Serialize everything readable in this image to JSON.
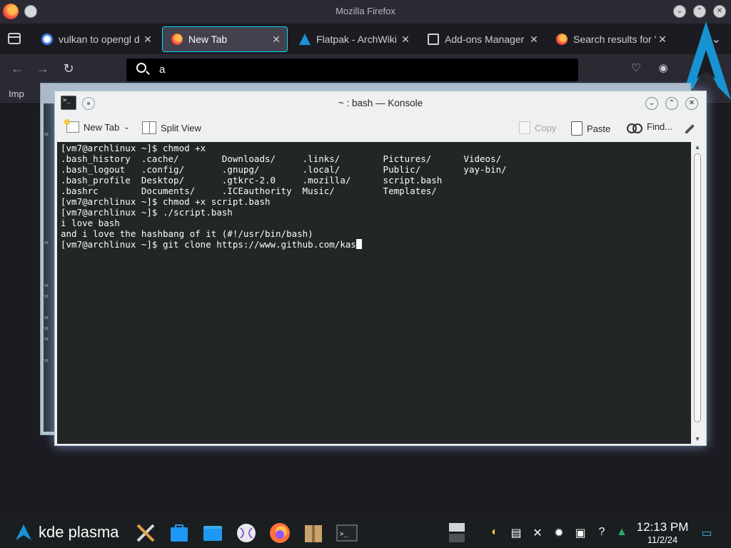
{
  "firefox": {
    "window_title": "Mozilla Firefox",
    "tabs": [
      {
        "label": "vulkan to opengl d",
        "active": false
      },
      {
        "label": "New Tab",
        "active": true
      },
      {
        "label": "Flatpak - ArchWiki",
        "active": false
      },
      {
        "label": "Add-ons Manager",
        "active": false
      },
      {
        "label": "Search results for '",
        "active": false
      }
    ],
    "tab_close_glyph": "✕",
    "url_value": "a",
    "bookmark_import_label": "Imp"
  },
  "konsole": {
    "title": "~ : bash — Konsole",
    "toolbar": {
      "new_tab": "New Tab",
      "split_view": "Split View",
      "copy": "Copy",
      "paste": "Paste",
      "find": "Find..."
    },
    "terminal_lines": [
      "[vm7@archlinux ~]$ chmod +x",
      ".bash_history  .cache/        Downloads/     .links/        Pictures/      Videos/",
      ".bash_logout   .config/       .gnupg/        .local/        Public/        yay-bin/",
      ".bash_profile  Desktop/       .gtkrc-2.0     .mozilla/      script.bash",
      ".bashrc        Documents/     .ICEauthority  Music/         Templates/",
      "[vm7@archlinux ~]$ chmod +x script.bash",
      "[vm7@archlinux ~]$ ./script.bash",
      "i love bash",
      "and i love the hashbang of it (#!/usr/bin/bash)"
    ],
    "current_input": "[vm7@archlinux ~]$ git clone https://www.github.com/kas"
  },
  "taskbar": {
    "start_label": "kde plasma",
    "clock_time": "12:13 PM",
    "clock_date": "11/2/24"
  },
  "colors": {
    "firefox_bg": "#1c1b22",
    "terminal_bg": "#232627",
    "accent": "#3daee9",
    "active_tab_border": "#00ddff"
  }
}
